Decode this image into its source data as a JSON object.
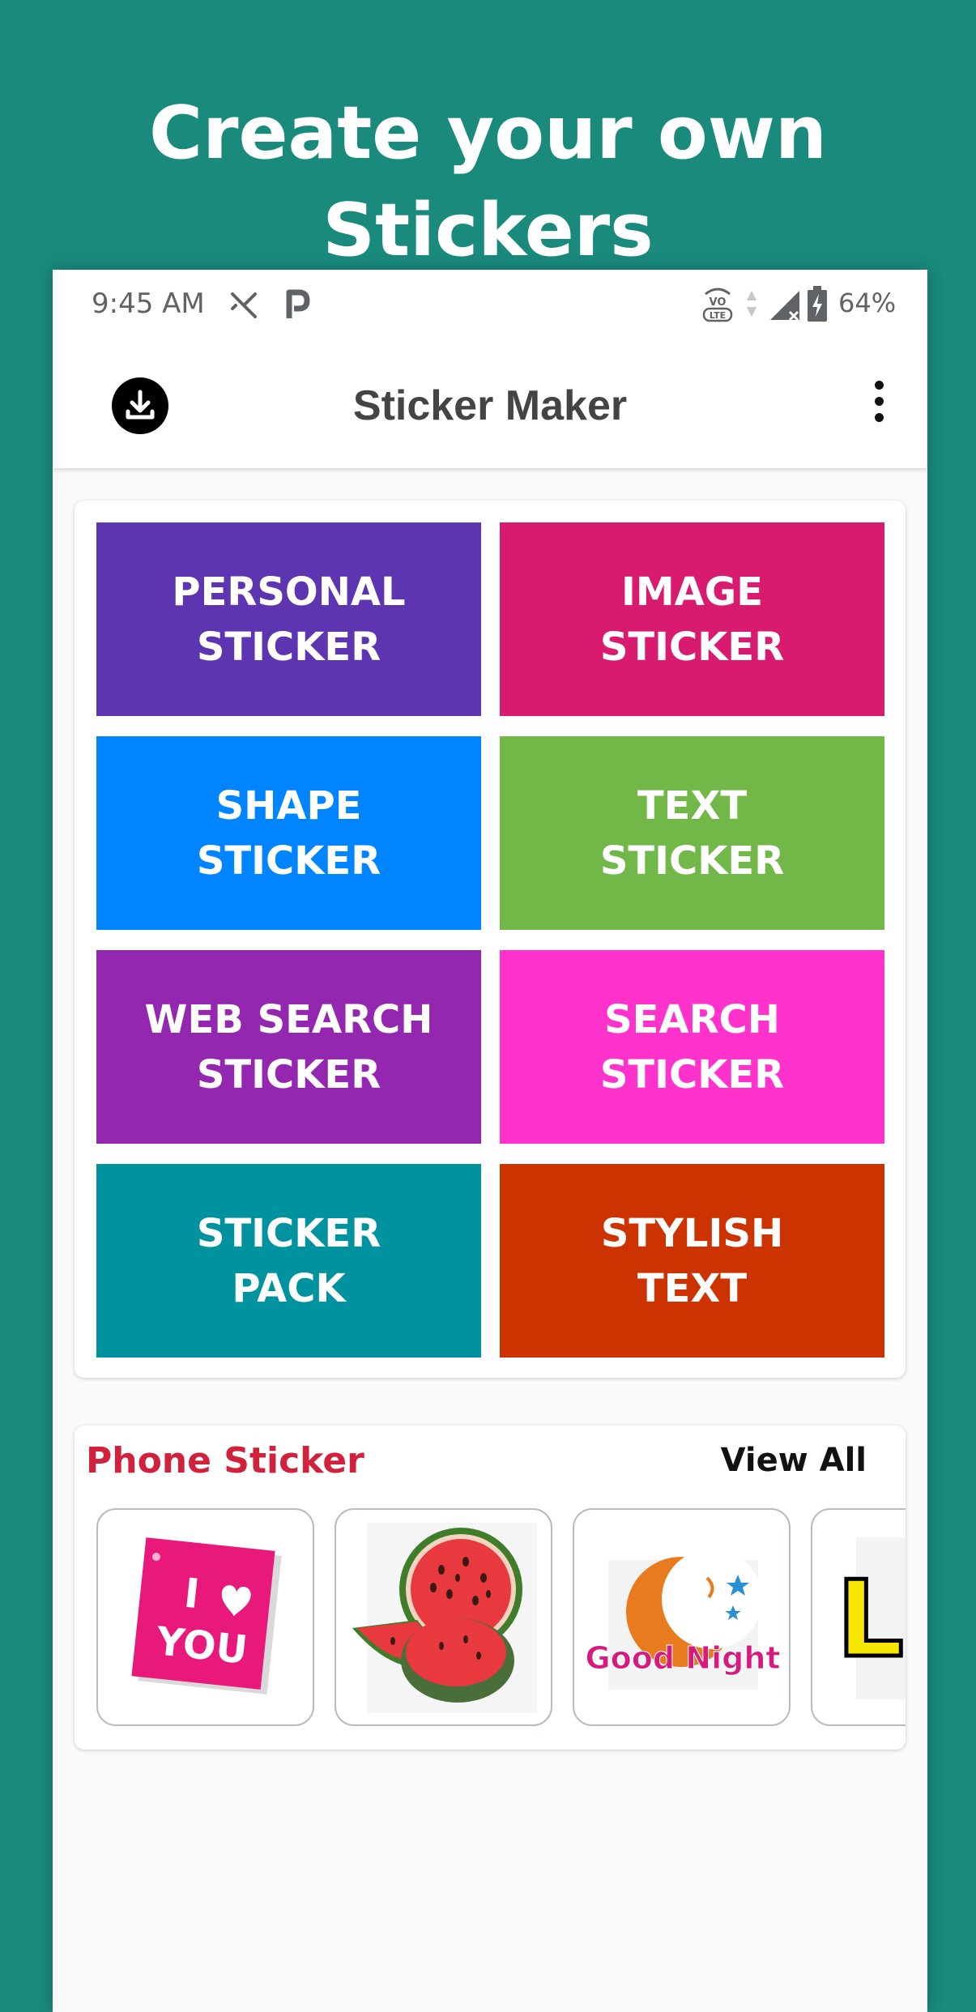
{
  "headline": "Create your own Stickers",
  "status_bar": {
    "time": "9:45 AM",
    "battery": "64%",
    "lte": "LTE",
    "volte": "VO"
  },
  "app_bar": {
    "title": "Sticker Maker"
  },
  "tiles": [
    {
      "label": "PERSONAL\nSTICKER",
      "color": "#5e35b1"
    },
    {
      "label": "IMAGE\nSTICKER",
      "color": "#d81b6f"
    },
    {
      "label": "SHAPE\nSTICKER",
      "color": "#0084ff"
    },
    {
      "label": "TEXT\nSTICKER",
      "color": "#71b849"
    },
    {
      "label": "WEB SEARCH\nSTICKER",
      "color": "#9427b0"
    },
    {
      "label": "SEARCH\nSTICKER",
      "color": "#ff33cc"
    },
    {
      "label": "STICKER\nPACK",
      "color": "#00929e"
    },
    {
      "label": "STYLISH\nTEXT",
      "color": "#cc3300"
    }
  ],
  "phone_sticker": {
    "title": "Phone Sticker",
    "view_all": "View All",
    "stickers": [
      {
        "name": "i-love-you-sticker",
        "line1": "I",
        "line2": "YOU"
      },
      {
        "name": "watermelon-sticker"
      },
      {
        "name": "good-night-sticker",
        "text": "Good Night"
      },
      {
        "name": "partial-letters-sticker",
        "text": "Lo"
      }
    ]
  }
}
